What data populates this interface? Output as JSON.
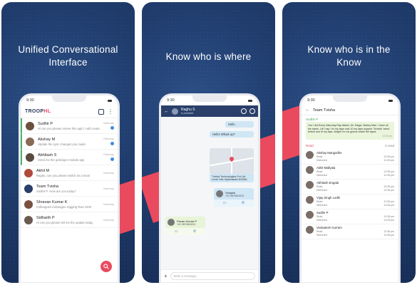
{
  "panels": [
    {
      "headline_line1": "Unified Conversational",
      "headline_line2": "Interface",
      "phone": {
        "time": "9:30",
        "logo_main": "TROOP",
        "logo_accent": "HL",
        "chats": [
          {
            "name": "Sudhir P",
            "message": "Hi can you please review this app? I will create",
            "time": "Yesterday",
            "unread": true,
            "avatar_color": "#6b4f3f"
          },
          {
            "name": "Akshay M",
            "message": "Update the sync changes you made",
            "time": "Yesterday",
            "unread": true,
            "avatar_color": "#8a6a55"
          },
          {
            "name": "Abhilash S",
            "message": "Send me the goleniger module app",
            "time": "Yesterday",
            "unread": true,
            "avatar_color": "#5a4a40"
          },
          {
            "name": "Akhil M",
            "message": "Raghu, can you please switch as a team",
            "time": "Yesterday",
            "unread": false,
            "avatar_color": "#b04a3a"
          },
          {
            "name": "Team Tvisha",
            "message": "Sudhir P: How are you today?",
            "time": "Yesterday",
            "unread": false,
            "avatar_color": "#2a3f6a"
          },
          {
            "name": "Shravan Kumar K",
            "message": "Colleagues messages Jogging Ravi 1200",
            "time": "Yesterday",
            "unread": false,
            "avatar_color": "#7a5040"
          },
          {
            "name": "Sidharth P",
            "message": "Hi can you please tell me the update today",
            "time": "Yesterday",
            "unread": false,
            "avatar_color": "#6a5a50"
          }
        ]
      }
    },
    {
      "headline_line1": "Know who is where",
      "phone": {
        "time": "9:30",
        "chat_title": "Raghu S",
        "chat_subtitle": "is available",
        "bubble_1": "Hello",
        "bubble_2": "Hello! Whats up?",
        "map_label": "Tvisha Technologies Pvt Ltd Level Hitc Hyderabad 500081",
        "contact_1_name": "Vinaysh",
        "contact_1_phone": "+91 9876543210",
        "contact_2_name": "Pavan Kumar P",
        "contact_2_phone": "+91 9876543210",
        "compose_placeholder": "Write a message..."
      }
    },
    {
      "headline_line1": "Know who is in the",
      "headline_line2": "Know",
      "phone": {
        "time": "9:30",
        "title": "Team Tvisha",
        "sender": "Sudhir P",
        "quote": "You I did Every Saturday Rap Attack, Mr. Magic, Marley Marl. I have all the tapes. Lift I cap. Ho my tape cost 10 my tape popped. Smokin' weed before and lit my tape. Alright I'm not gonna chase the tapes",
        "quote_time": "12:00 pm",
        "read_label": "Read",
        "read_count": "6 read",
        "readers": [
          {
            "name": "Akshay Mangodhe",
            "read": "12:35 pm",
            "delivered": "12:28 pm"
          },
          {
            "name": "Akhil Mallyala",
            "read": "12:35 pm",
            "delivered": "12:28 pm"
          },
          {
            "name": "Abhilash Engala",
            "read": "12:35 pm",
            "delivered": "12:28 pm"
          },
          {
            "name": "Vijay Singh Lodhi",
            "read": "12:35 pm",
            "delivered": "12:28 pm"
          },
          {
            "name": "Sudhir P",
            "read": "12:35 pm",
            "delivered": "12:28 pm"
          },
          {
            "name": "Venkatesh Gurram",
            "read": "12:35 pm",
            "delivered": "12:28 pm"
          }
        ],
        "read_word": "Read",
        "delivered_word": "Delivered"
      }
    }
  ],
  "colors": {
    "accent": "#e94a5e",
    "navy": "#203d6e",
    "green": "#48b56a"
  }
}
